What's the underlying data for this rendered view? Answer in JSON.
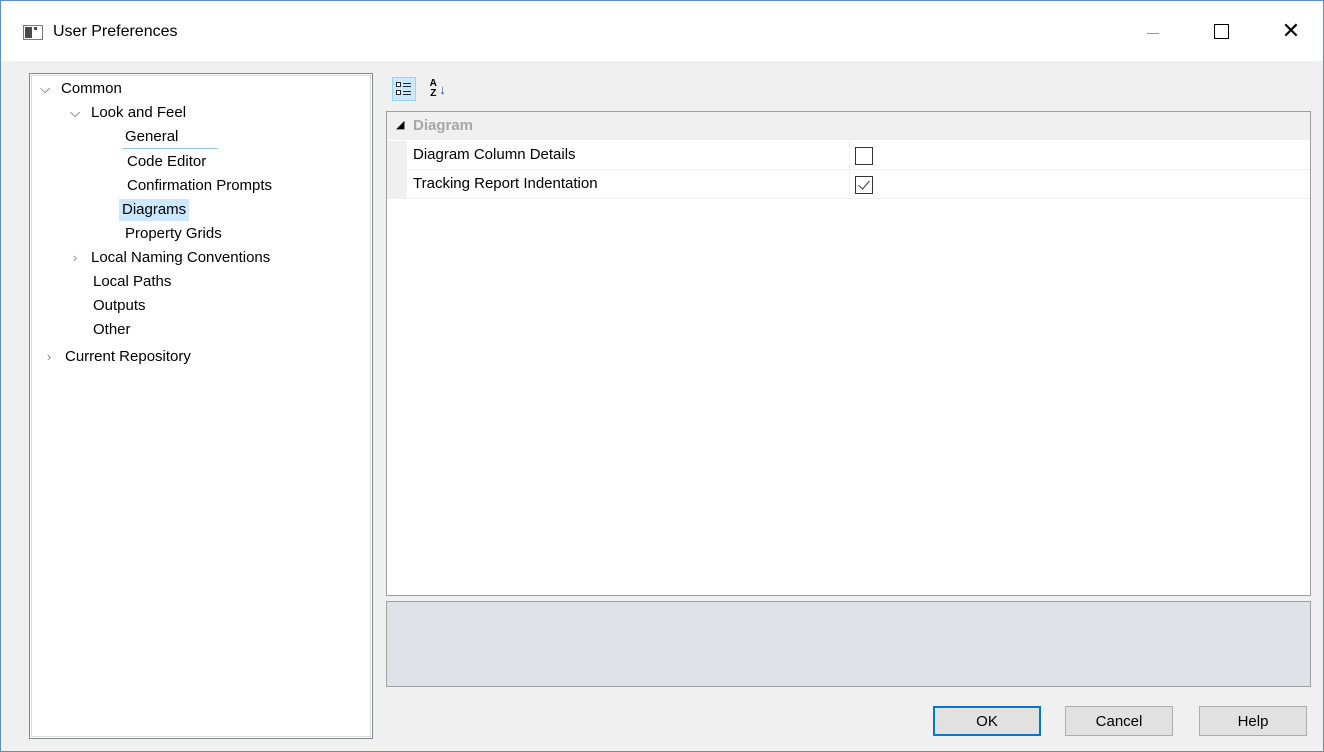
{
  "window": {
    "title": "User Preferences"
  },
  "tree": {
    "items": [
      {
        "label": "Common",
        "expanded": true
      },
      {
        "label": "Look and Feel",
        "expanded": true
      },
      {
        "label": "General",
        "state": "focused"
      },
      {
        "label": "Code Editor"
      },
      {
        "label": "Confirmation Prompts"
      },
      {
        "label": "Diagrams",
        "state": "selected"
      },
      {
        "label": "Property Grids"
      },
      {
        "label": "Local Naming Conventions",
        "expanded": false
      },
      {
        "label": "Local Paths"
      },
      {
        "label": "Outputs"
      },
      {
        "label": "Other"
      },
      {
        "label": "Current Repository",
        "expanded": false
      }
    ]
  },
  "property_grid": {
    "toolbar": {
      "categorized_icon": "categorized-icon",
      "alphabetical_icon": "sort-alphabetical-icon",
      "alphabetical_glyph": "A Z"
    },
    "category": "Diagram",
    "rows": [
      {
        "name": "Diagram Column Details",
        "checked": false
      },
      {
        "name": "Tracking Report Indentation",
        "checked": true
      }
    ]
  },
  "buttons": {
    "ok": "OK",
    "cancel": "Cancel",
    "help": "Help"
  },
  "colors": {
    "selection": "#cce8ff",
    "focus_border": "#0078d7",
    "description_bg": "#dee1e6"
  }
}
